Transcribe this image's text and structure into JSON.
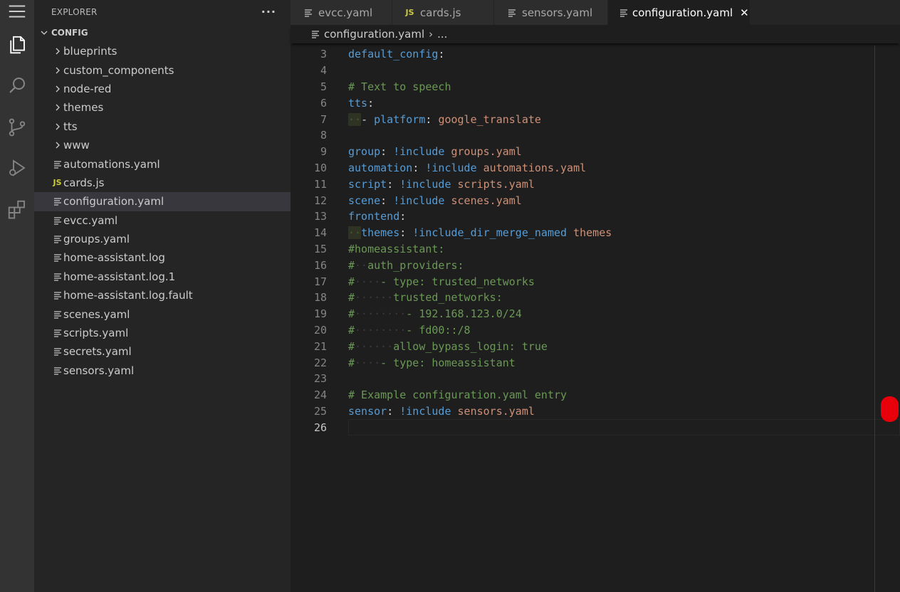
{
  "activity_bar": {
    "icons": [
      "menu-icon",
      "explorer-icon",
      "search-icon",
      "source-control-icon",
      "run-debug-icon",
      "extensions-icon"
    ]
  },
  "sidebar": {
    "title": "EXPLORER",
    "more": "···",
    "folder": "CONFIG",
    "items": [
      {
        "label": "blueprints",
        "type": "folder"
      },
      {
        "label": "custom_components",
        "type": "folder"
      },
      {
        "label": "node-red",
        "type": "folder"
      },
      {
        "label": "themes",
        "type": "folder"
      },
      {
        "label": "tts",
        "type": "folder"
      },
      {
        "label": "www",
        "type": "folder"
      },
      {
        "label": "automations.yaml",
        "type": "file"
      },
      {
        "label": "cards.js",
        "type": "js"
      },
      {
        "label": "configuration.yaml",
        "type": "file",
        "selected": true
      },
      {
        "label": "evcc.yaml",
        "type": "file"
      },
      {
        "label": "groups.yaml",
        "type": "file"
      },
      {
        "label": "home-assistant.log",
        "type": "file"
      },
      {
        "label": "home-assistant.log.1",
        "type": "file"
      },
      {
        "label": "home-assistant.log.fault",
        "type": "file"
      },
      {
        "label": "scenes.yaml",
        "type": "file"
      },
      {
        "label": "scripts.yaml",
        "type": "file"
      },
      {
        "label": "secrets.yaml",
        "type": "file"
      },
      {
        "label": "sensors.yaml",
        "type": "file"
      }
    ]
  },
  "tabs": [
    {
      "label": "evcc.yaml",
      "icon": "file-lines-icon"
    },
    {
      "label": "cards.js",
      "icon": "js-icon"
    },
    {
      "label": "sensors.yaml",
      "icon": "file-lines-icon"
    },
    {
      "label": "configuration.yaml",
      "icon": "file-lines-icon",
      "active": true,
      "close": "✕"
    }
  ],
  "breadcrumb": {
    "file": "configuration.yaml",
    "sep": "›",
    "more": "..."
  },
  "editor": {
    "current_line": 26,
    "lines": [
      {
        "n": "3",
        "t": [
          [
            "k",
            "default_config"
          ],
          [
            "p",
            ":"
          ]
        ]
      },
      {
        "n": "4",
        "t": []
      },
      {
        "n": "5",
        "t": [
          [
            "c",
            "# Text to speech"
          ]
        ]
      },
      {
        "n": "6",
        "t": [
          [
            "k",
            "tts"
          ],
          [
            "p",
            ":"
          ]
        ]
      },
      {
        "n": "7",
        "t": [
          [
            "ind",
            "··"
          ],
          [
            "p",
            "- "
          ],
          [
            "k",
            "platform"
          ],
          [
            "p",
            ": "
          ],
          [
            "s",
            "google_translate"
          ]
        ]
      },
      {
        "n": "8",
        "t": []
      },
      {
        "n": "9",
        "t": [
          [
            "k",
            "group"
          ],
          [
            "p",
            ": "
          ],
          [
            "k",
            "!include"
          ],
          [
            "p",
            " "
          ],
          [
            "s",
            "groups.yaml"
          ]
        ]
      },
      {
        "n": "10",
        "t": [
          [
            "k",
            "automation"
          ],
          [
            "p",
            ": "
          ],
          [
            "k",
            "!include"
          ],
          [
            "p",
            " "
          ],
          [
            "s",
            "automations.yaml"
          ]
        ]
      },
      {
        "n": "11",
        "t": [
          [
            "k",
            "script"
          ],
          [
            "p",
            ": "
          ],
          [
            "k",
            "!include"
          ],
          [
            "p",
            " "
          ],
          [
            "s",
            "scripts.yaml"
          ]
        ]
      },
      {
        "n": "12",
        "t": [
          [
            "k",
            "scene"
          ],
          [
            "p",
            ": "
          ],
          [
            "k",
            "!include"
          ],
          [
            "p",
            " "
          ],
          [
            "s",
            "scenes.yaml"
          ]
        ]
      },
      {
        "n": "13",
        "t": [
          [
            "k",
            "frontend"
          ],
          [
            "p",
            ":"
          ]
        ]
      },
      {
        "n": "14",
        "t": [
          [
            "ind",
            "··"
          ],
          [
            "k",
            "themes"
          ],
          [
            "p",
            ": "
          ],
          [
            "k",
            "!include_dir_merge_named"
          ],
          [
            "p",
            " "
          ],
          [
            "s",
            "themes"
          ]
        ]
      },
      {
        "n": "15",
        "t": [
          [
            "c",
            "#homeassistant:"
          ]
        ]
      },
      {
        "n": "16",
        "t": [
          [
            "c",
            "#"
          ],
          [
            "ws",
            "··"
          ],
          [
            "c",
            "auth_providers:"
          ]
        ]
      },
      {
        "n": "17",
        "t": [
          [
            "c",
            "#"
          ],
          [
            "ws",
            "····"
          ],
          [
            "c",
            "- type: trusted_networks"
          ]
        ]
      },
      {
        "n": "18",
        "t": [
          [
            "c",
            "#"
          ],
          [
            "ws",
            "······"
          ],
          [
            "c",
            "trusted_networks:"
          ]
        ]
      },
      {
        "n": "19",
        "t": [
          [
            "c",
            "#"
          ],
          [
            "ws",
            "········"
          ],
          [
            "c",
            "- 192.168.123.0/24"
          ]
        ]
      },
      {
        "n": "20",
        "t": [
          [
            "c",
            "#"
          ],
          [
            "ws",
            "········"
          ],
          [
            "c",
            "- fd00::/8"
          ]
        ]
      },
      {
        "n": "21",
        "t": [
          [
            "c",
            "#"
          ],
          [
            "ws",
            "······"
          ],
          [
            "c",
            "allow_bypass_login: true"
          ]
        ]
      },
      {
        "n": "22",
        "t": [
          [
            "c",
            "#"
          ],
          [
            "ws",
            "····"
          ],
          [
            "c",
            "- type: homeassistant"
          ]
        ]
      },
      {
        "n": "23",
        "t": []
      },
      {
        "n": "24",
        "t": [
          [
            "c",
            "# Example configuration.yaml entry"
          ]
        ]
      },
      {
        "n": "25",
        "t": [
          [
            "k",
            "sensor"
          ],
          [
            "p",
            ": "
          ],
          [
            "k",
            "!include"
          ],
          [
            "p",
            " "
          ],
          [
            "s",
            "sensors.yaml"
          ]
        ]
      },
      {
        "n": "26",
        "t": []
      }
    ]
  },
  "colors": {
    "keyword": "#569cd6",
    "string": "#ce9178",
    "comment": "#6a9955",
    "marker": "#e8000a"
  }
}
